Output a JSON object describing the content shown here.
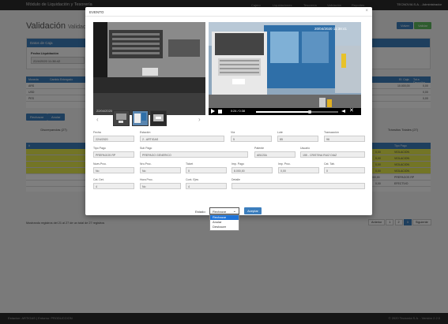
{
  "topbar": {
    "brand": "Módulo de Liquidación y Tesorería",
    "nav": [
      "Cajero",
      "Liquidaciones",
      "Tesorería",
      "Validación",
      "Reportes"
    ],
    "user": "TECNOVIA S.A. - Administrador"
  },
  "page": {
    "title": "Validación",
    "subtitle": "Validación",
    "btn_volver": "Volver",
    "btn_validar": "Validar",
    "panel_title": "Datos de Caja",
    "fecha_liq_label": "Fecha Liquidación",
    "fecha_liq_value": "22/4/2020 11:38:42",
    "btn_rechazar": "Rechazar",
    "btn_anular": "Anular"
  },
  "background_table": {
    "headers": [
      "Moneda",
      "Cambio Entregado",
      "",
      "",
      "",
      "",
      "",
      "",
      "Ef. Caja",
      "Tot a Depositar"
    ],
    "rows": [
      {
        "moneda": "ARS",
        "v1": "0",
        "caja": "10.000,00",
        "dep": "0,00"
      },
      {
        "moneda": "USD",
        "v1": "0",
        "caja": "0,00",
        "dep": "0,00"
      },
      {
        "moneda": "PES",
        "v1": "0",
        "caja": "0,00",
        "dep": "0,00"
      },
      {
        "moneda": "REA",
        "v1": "0",
        "caja": "0,00",
        "dep": "0,00"
      }
    ],
    "summary_left": "Discrepancias (27)",
    "summary_right": "Tránsitos Totales (27)",
    "detail_headers": [
      "#",
      "Est",
      "Est",
      "Tipo Pago"
    ],
    "detail_rows": [
      {
        "a": "12",
        "b": "1",
        "val": "0,00",
        "tipo": "VIOLACION",
        "yellow": true
      },
      {
        "a": "12",
        "b": "1",
        "val": "0,00",
        "tipo": "VIOLACION",
        "yellow": true
      },
      {
        "a": "12",
        "b": "1",
        "val": "0,00",
        "tipo": "VIOLACION",
        "yellow": true
      },
      {
        "a": "12",
        "b": "1",
        "val": "0,00",
        "tipo": "VIOLACION",
        "yellow": true
      },
      {
        "a": "12",
        "b": "1",
        "val": "8.000,00",
        "tipo": "PREPAGOS RP",
        "yellow": false
      },
      {
        "a": "12",
        "b": "1",
        "val": "0,00",
        "tipo": "EFECTIVO",
        "yellow": false
      }
    ],
    "showing": "Mostrando registros del 21 al 27 de un total de 27 registros",
    "pagination": [
      "Anterior",
      "1",
      "2",
      "3",
      "Siguiente"
    ]
  },
  "footer": {
    "left": "Estacion: ARTIGAS | Entorno: PRODUCCION",
    "right": "© 2020 Tecnovia S.A. - Versión 2.2.0"
  },
  "modal": {
    "title": "EVENTO",
    "close": "×",
    "video": {
      "time": "0:24 / 0:38"
    },
    "truck_plate": "AA 123 BC",
    "overlay_text": "20/04/2020 11:38:41",
    "fields": {
      "fecha": {
        "label": "Fecha",
        "value": "22/4/2020"
      },
      "estacion": {
        "label": "Estación",
        "value": "2 - ARTIGAS"
      },
      "via": {
        "label": "Vía",
        "value": "5"
      },
      "lote": {
        "label": "Lote",
        "value": "85"
      },
      "transaccion": {
        "label": "Transacción",
        "value": "96"
      },
      "tipo_pago": {
        "label": "Tipo Pago",
        "value": "PREPAGOS RP"
      },
      "sub_pago": {
        "label": "Sub Pago",
        "value": "PREPAGO GENERICO"
      },
      "patente": {
        "label": "Patente",
        "value": "AB123A"
      },
      "usuario": {
        "label": "Usuario",
        "value": "155 - CRISTINA RUIZ DIAZ"
      },
      "nueva_proc": {
        "label": "Nuev.Proc.",
        "value": "No"
      },
      "nro_proc": {
        "label": "Nro.Proc.",
        "value": "No"
      },
      "ticket": {
        "label": "Ticket",
        "value": "0"
      },
      "imp_pago": {
        "label": "Imp. Pago",
        "value": "8.000,00"
      },
      "imp_proc": {
        "label": "Imp. Proc.",
        "value": "0,00"
      },
      "cat_tab": {
        "label": "Cat. Tab.",
        "value": "0"
      },
      "cat_det": {
        "label": "Cat. Det.",
        "value": "4"
      },
      "hora_proc": {
        "label": "Hora Proc.",
        "value": "No"
      },
      "cont_ejes": {
        "label": "Cont. Ejes",
        "value": "4"
      },
      "detalle": {
        "label": "Detalle",
        "value": ""
      }
    },
    "estado_label": "Estado:",
    "estado_selected": "Rechazar",
    "estado_options": [
      "Rechazar",
      "Anular",
      "Deshacer"
    ],
    "aceptar_label": "Aceptar"
  }
}
